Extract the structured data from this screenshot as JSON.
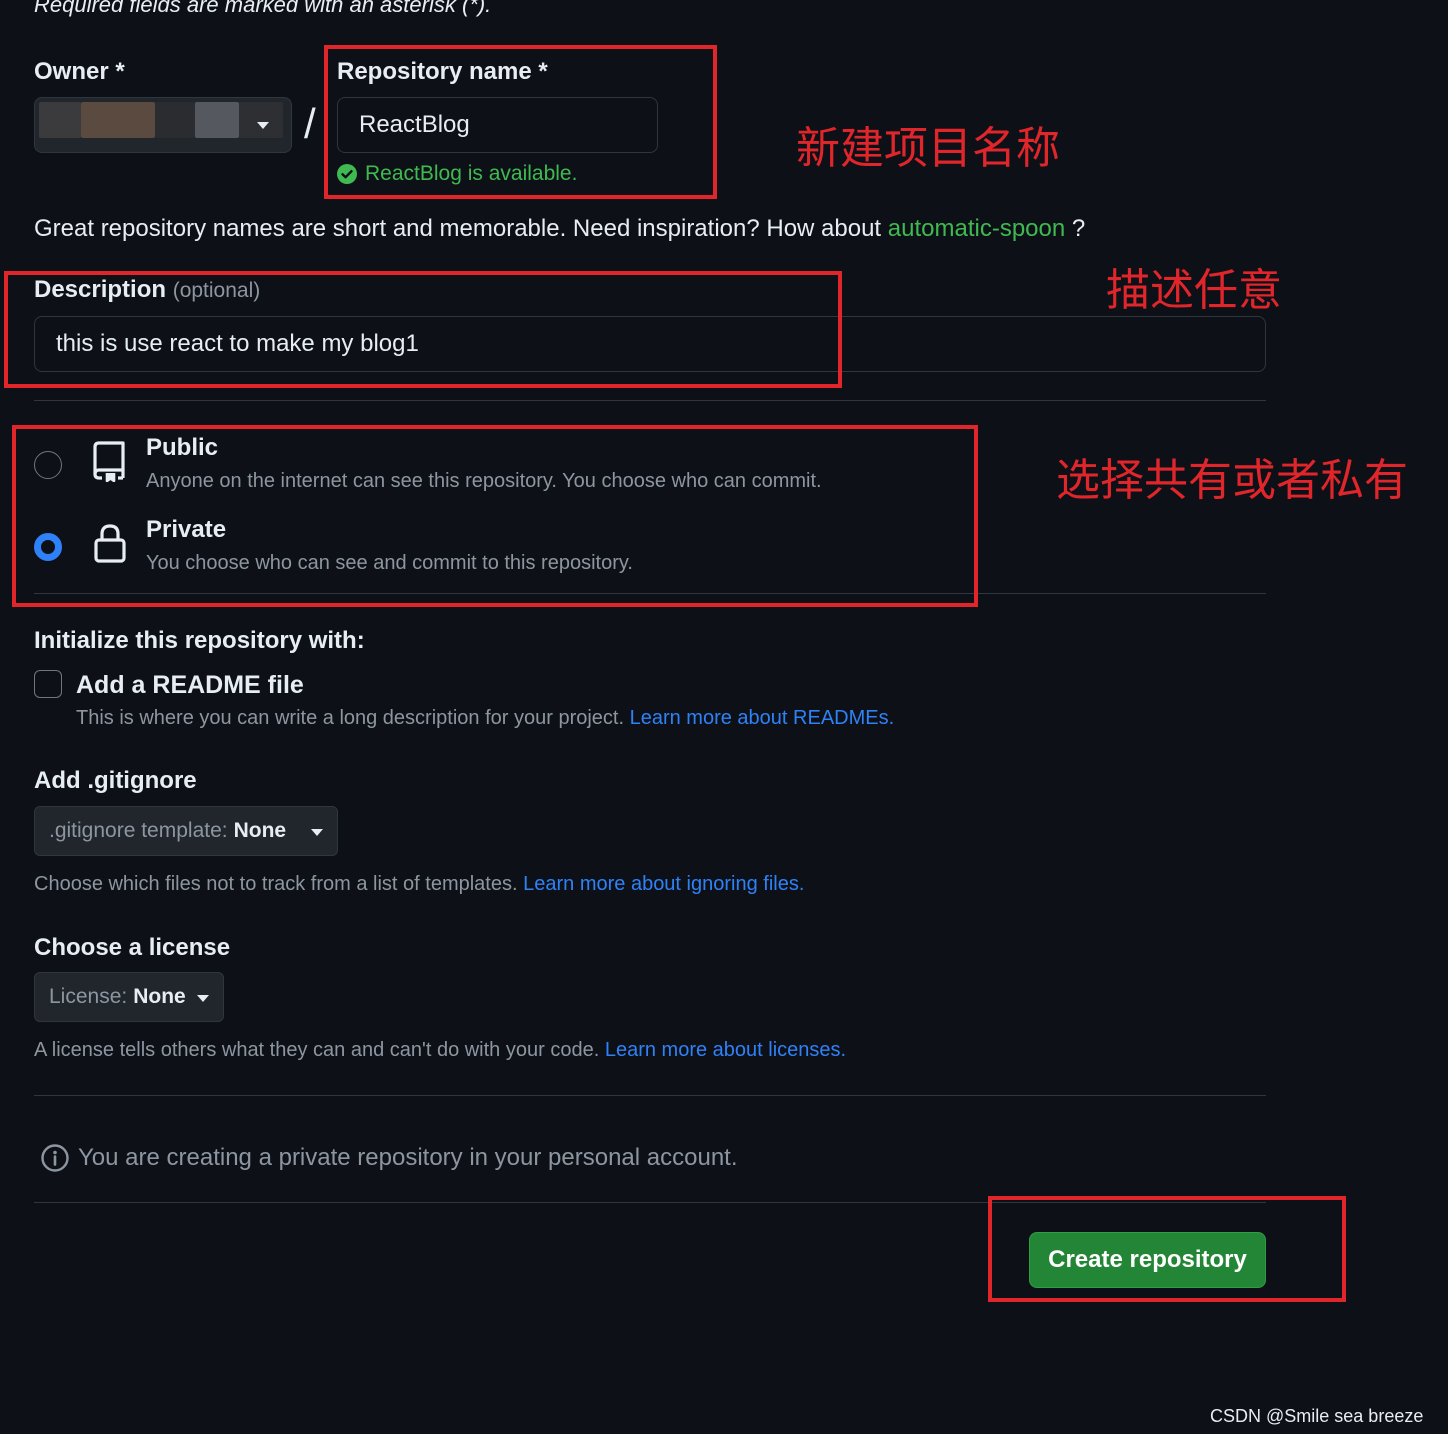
{
  "form": {
    "required_note": "Required fields are marked with an asterisk (*).",
    "owner_label": "Owner *",
    "slash": "/",
    "repo_name_label": "Repository name *",
    "repo_name_value": "ReactBlog",
    "availability": "ReactBlog is available.",
    "hint_prefix": "Great repository names are short and memorable. Need inspiration? How about",
    "hint_suggestion": "automatic-spoon",
    "hint_suffix": "?",
    "description_label": "Description",
    "description_optional": "(optional)",
    "description_value": "this is use react to make my blog1"
  },
  "visibility": {
    "public_title": "Public",
    "public_desc": "Anyone on the internet can see this repository. You choose who can commit.",
    "private_title": "Private",
    "private_desc": "You choose who can see and commit to this repository.",
    "selected": "private"
  },
  "initialize": {
    "heading": "Initialize this repository with:",
    "readme_label": "Add a README file",
    "readme_desc": "This is where you can write a long description for your project.",
    "readme_link": "Learn more about READMEs.",
    "readme_checked": false,
    "gitignore_heading": "Add .gitignore",
    "gitignore_select_label": ".gitignore template:",
    "gitignore_select_value": "None",
    "gitignore_desc": "Choose which files not to track from a list of templates.",
    "gitignore_link": "Learn more about ignoring files.",
    "license_heading": "Choose a license",
    "license_select_label": "License:",
    "license_select_value": "None",
    "license_desc": "A license tells others what they can and can't do with your code.",
    "license_link": "Learn more about licenses."
  },
  "footer": {
    "info": "You are creating a private repository in your personal account.",
    "create_button": "Create repository"
  },
  "annotations": {
    "name_note": "新建项目名称",
    "desc_note": "描述任意",
    "visibility_note": "选择共有或者私有"
  },
  "watermark": "CSDN @Smile sea breeze",
  "colors": {
    "background": "#0d1117",
    "accent_green": "#238636",
    "success_green": "#3fb950",
    "link_blue": "#2f81f7",
    "annotation_red": "#e0252b"
  },
  "icons": {
    "success": "check-circle-icon",
    "public": "repo-icon",
    "private": "lock-icon",
    "info": "info-icon",
    "dropdown": "caret-down-icon"
  }
}
